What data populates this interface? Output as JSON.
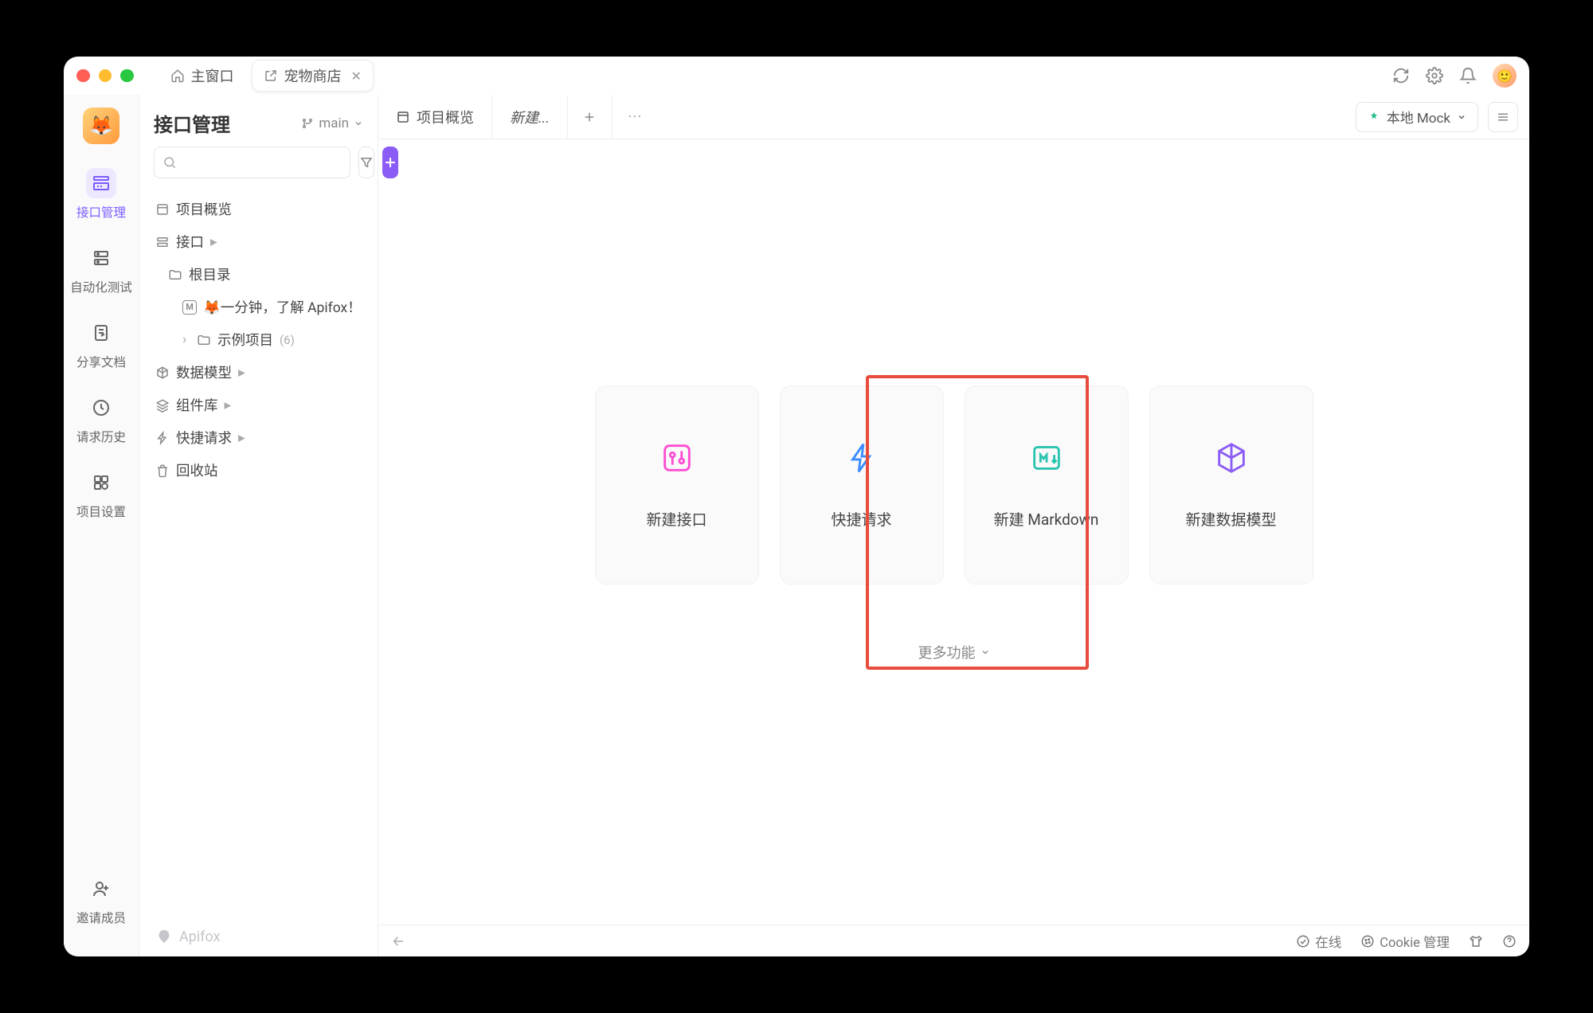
{
  "titlebar": {
    "tabs": [
      {
        "label": "主窗口"
      },
      {
        "label": "宠物商店"
      }
    ]
  },
  "rail": {
    "items": [
      {
        "label": "接口管理"
      },
      {
        "label": "自动化测试"
      },
      {
        "label": "分享文档"
      },
      {
        "label": "请求历史"
      },
      {
        "label": "项目设置"
      }
    ],
    "invite": "邀请成员"
  },
  "sidebar": {
    "title": "接口管理",
    "branch": "main",
    "tree": {
      "overview": "项目概览",
      "api": "接口",
      "root": "根目录",
      "intro": "🦊一分钟，了解 Apifox！",
      "example": "示例项目",
      "example_count": "(6)",
      "data_model": "数据模型",
      "components": "组件库",
      "quick_request": "快捷请求",
      "trash": "回收站"
    },
    "footer": "Apifox"
  },
  "tabs": {
    "overview": "项目概览",
    "new": "新建...",
    "env": "本地 Mock"
  },
  "cards": [
    {
      "label": "新建接口"
    },
    {
      "label": "快捷请求"
    },
    {
      "label": "新建 Markdown"
    },
    {
      "label": "新建数据模型"
    }
  ],
  "more_features": "更多功能",
  "statusbar": {
    "online": "在线",
    "cookie": "Cookie 管理"
  }
}
